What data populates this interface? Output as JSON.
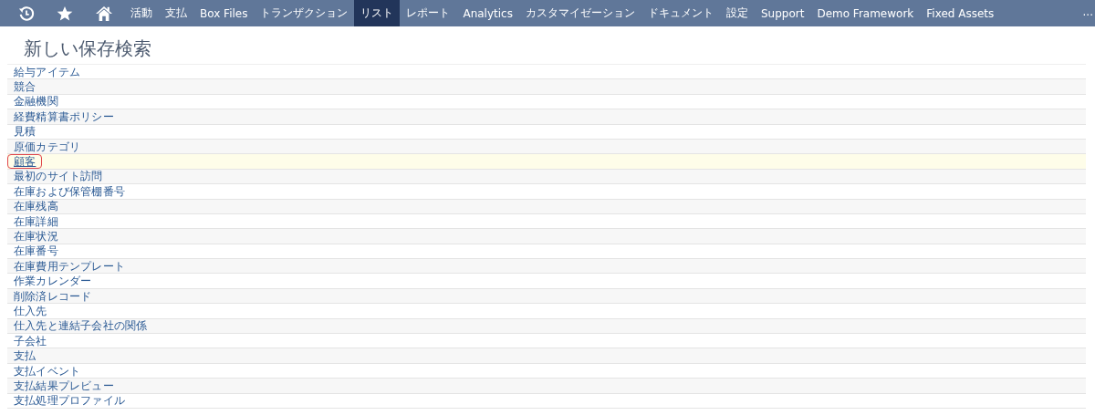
{
  "nav": {
    "items": [
      {
        "kind": "icon",
        "selected": false
      },
      {
        "kind": "icon",
        "selected": false
      },
      {
        "kind": "icon",
        "selected": false
      },
      {
        "kind": "text",
        "label": "活動",
        "selected": false
      },
      {
        "kind": "text",
        "label": "支払",
        "selected": false
      },
      {
        "kind": "text",
        "label": "Box Files",
        "selected": false
      },
      {
        "kind": "text",
        "label": "トランザクション",
        "selected": false
      },
      {
        "kind": "text",
        "label": "リスト",
        "selected": true
      },
      {
        "kind": "text",
        "label": "レポート",
        "selected": false
      },
      {
        "kind": "text",
        "label": "Analytics",
        "selected": false
      },
      {
        "kind": "text",
        "label": "カスタマイゼーション",
        "selected": false
      },
      {
        "kind": "text",
        "label": "ドキュメント",
        "selected": false
      },
      {
        "kind": "text",
        "label": "設定",
        "selected": false
      },
      {
        "kind": "text",
        "label": "Support",
        "selected": false
      },
      {
        "kind": "text",
        "label": "Demo Framework",
        "selected": false
      },
      {
        "kind": "text",
        "label": "Fixed Assets",
        "selected": false
      }
    ],
    "more": "..."
  },
  "title": "新しい保存検索",
  "list": [
    {
      "label": "給与アイテム",
      "selected": false
    },
    {
      "label": "競合",
      "selected": false
    },
    {
      "label": "金融機関",
      "selected": false
    },
    {
      "label": "経費精算書ポリシー",
      "selected": false
    },
    {
      "label": "見積",
      "selected": false
    },
    {
      "label": "原価カテゴリ",
      "selected": false
    },
    {
      "label": "顧客",
      "selected": true
    },
    {
      "label": "最初のサイト訪問",
      "selected": false
    },
    {
      "label": "在庫および保管棚番号",
      "selected": false
    },
    {
      "label": "在庫残高",
      "selected": false
    },
    {
      "label": "在庫詳細",
      "selected": false
    },
    {
      "label": "在庫状況",
      "selected": false
    },
    {
      "label": "在庫番号",
      "selected": false
    },
    {
      "label": "在庫費用テンプレート",
      "selected": false
    },
    {
      "label": "作業カレンダー",
      "selected": false
    },
    {
      "label": "削除済レコード",
      "selected": false
    },
    {
      "label": "仕入先",
      "selected": false
    },
    {
      "label": "仕入先と連結子会社の関係",
      "selected": false
    },
    {
      "label": "子会社",
      "selected": false
    },
    {
      "label": "支払",
      "selected": false
    },
    {
      "label": "支払イベント",
      "selected": false
    },
    {
      "label": "支払結果プレビュー",
      "selected": false
    },
    {
      "label": "支払処理プロファイル",
      "selected": false
    }
  ]
}
